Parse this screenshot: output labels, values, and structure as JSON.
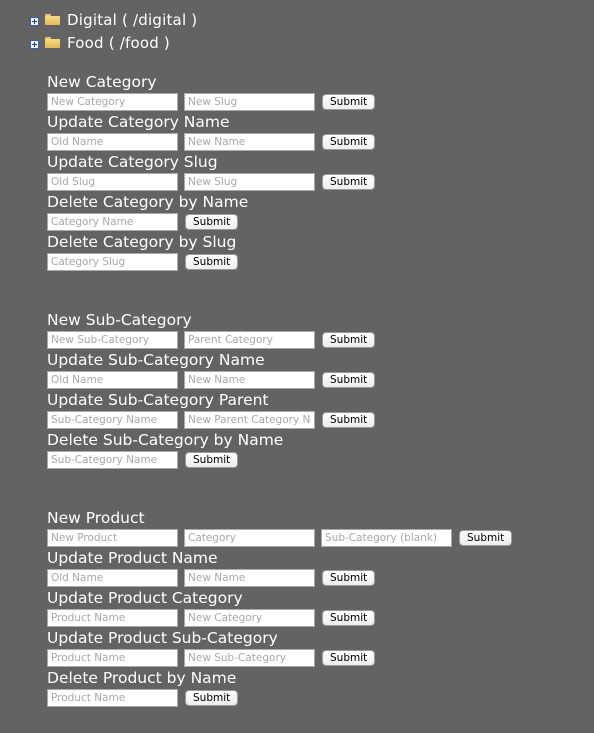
{
  "tree": {
    "items": [
      {
        "label": "Digital ( /digital )"
      },
      {
        "label": "Food ( /food )"
      }
    ]
  },
  "category_forms": [
    {
      "heading": "New Category",
      "fields": [
        "New Category",
        "New Slug"
      ],
      "submit": "Submit"
    },
    {
      "heading": "Update Category Name",
      "fields": [
        "Old Name",
        "New Name"
      ],
      "submit": "Submit"
    },
    {
      "heading": "Update Category Slug",
      "fields": [
        "Old Slug",
        "New Slug"
      ],
      "submit": "Submit"
    },
    {
      "heading": "Delete Category by Name",
      "fields": [
        "Category Name"
      ],
      "submit": "Submit"
    },
    {
      "heading": "Delete Category by Slug",
      "fields": [
        "Category Slug"
      ],
      "submit": "Submit"
    }
  ],
  "subcategory_forms": [
    {
      "heading": "New Sub-Category",
      "fields": [
        "New Sub-Category",
        "Parent Category"
      ],
      "submit": "Submit"
    },
    {
      "heading": "Update Sub-Category Name",
      "fields": [
        "Old Name",
        "New Name"
      ],
      "submit": "Submit"
    },
    {
      "heading": "Update Sub-Category Parent",
      "fields": [
        "Sub-Category Name",
        "New Parent Category N"
      ],
      "submit": "Submit"
    },
    {
      "heading": "Delete Sub-Category by Name",
      "fields": [
        "Sub-Category Name"
      ],
      "submit": "Submit"
    }
  ],
  "product_forms": [
    {
      "heading": "New Product",
      "fields": [
        "New Product",
        "Category",
        "Sub-Category (blank)"
      ],
      "submit": "Submit"
    },
    {
      "heading": "Update Product Name",
      "fields": [
        "Old Name",
        "New Name"
      ],
      "submit": "Submit"
    },
    {
      "heading": "Update Product Category",
      "fields": [
        "Product Name",
        "New Category"
      ],
      "submit": "Submit"
    },
    {
      "heading": "Update Product Sub-Category",
      "fields": [
        "Product Name",
        "New Sub-Category"
      ],
      "submit": "Submit"
    },
    {
      "heading": "Delete Product by Name",
      "fields": [
        "Product Name"
      ],
      "submit": "Submit"
    }
  ]
}
